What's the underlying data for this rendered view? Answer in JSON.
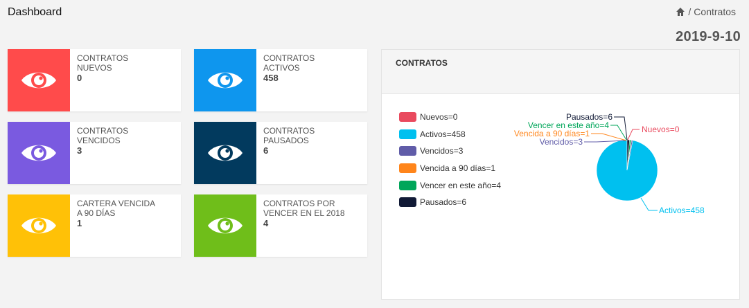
{
  "header": {
    "title": "Dashboard",
    "breadcrumb": "Contratos",
    "date": "2019-9-10"
  },
  "cards": [
    {
      "label": "CONTRATOS\nNUEVOS",
      "value": "0",
      "color": "#ff4b4b"
    },
    {
      "label": "CONTRATOS\nACTIVOS",
      "value": "458",
      "color": "#0e96ee"
    },
    {
      "label": "CONTRATOS\nVENCIDOS",
      "value": "3",
      "color": "#7a5ae0"
    },
    {
      "label": "CONTRATOS\nPAUSADOS",
      "value": "6",
      "color": "#023a5e"
    },
    {
      "label": "CARTERA VENCIDA\nA 90 DÍAS",
      "value": "1",
      "color": "#ffc107"
    },
    {
      "label": "CONTRATOS POR\nVENCER EN EL 2018",
      "value": "4",
      "color": "#6fbe1a"
    }
  ],
  "panel": {
    "title": "CONTRATOS"
  },
  "chart_data": {
    "type": "pie",
    "slices": [
      {
        "name": "Nuevos",
        "value": 0,
        "label": "Nuevos=0",
        "color": "#e94a5e"
      },
      {
        "name": "Activos",
        "value": 458,
        "label": "Activos=458",
        "color": "#00c0ef"
      },
      {
        "name": "Vencidos",
        "value": 3,
        "label": "Vencidos=3",
        "color": "#605ca8"
      },
      {
        "name": "Vencida a 90 días",
        "value": 1,
        "label": "Vencida a 90 días=1",
        "color": "#ff851b"
      },
      {
        "name": "Vencer en este año",
        "value": 4,
        "label": "Vencer en este año=4",
        "color": "#00a65a"
      },
      {
        "name": "Pausados",
        "value": 6,
        "label": "Pausados=6",
        "color": "#111a36"
      }
    ],
    "legend_position": "left"
  }
}
